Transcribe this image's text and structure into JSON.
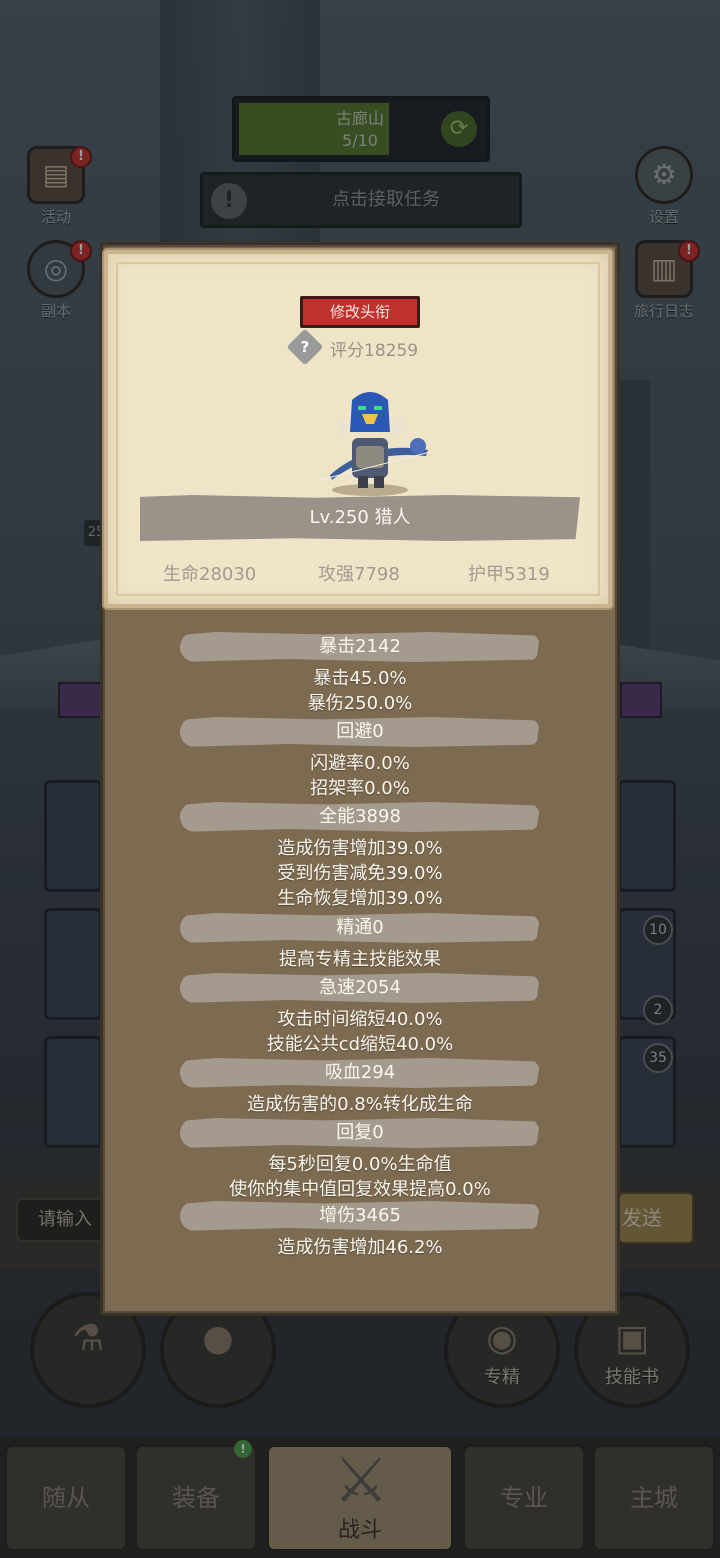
{
  "quest": {
    "name": "古廊山",
    "progress": "5/10",
    "task_label": "点击接取任务"
  },
  "side_buttons": {
    "activity": "活动",
    "dungeon": "副本",
    "settings": "设置",
    "journal": "旅行日志",
    "badge": "!"
  },
  "side_number": "25",
  "cards": {
    "c1": "10",
    "c2": "2",
    "c3": "35"
  },
  "chat": {
    "input_placeholder": "请输入",
    "send_label": "发送"
  },
  "round_buttons": {
    "specialize": "专精",
    "skill_book": "技能书"
  },
  "nav": {
    "followers": "随从",
    "equipment": "装备",
    "battle": "战斗",
    "profession": "专业",
    "main_city": "主城",
    "badge": "!"
  },
  "profile": {
    "change_title": "修改头衔",
    "help": "?",
    "score": "评分18259",
    "level_class": "Lv.250 猎人",
    "hp": "生命28030",
    "attack": "攻强7798",
    "armor": "护甲5319"
  },
  "stats": {
    "crit": {
      "header": "暴击2142",
      "lines": [
        "暴击45.0%",
        "暴伤250.0%"
      ]
    },
    "dodge": {
      "header": "回避0",
      "lines": [
        "闪避率0.0%",
        "招架率0.0%"
      ]
    },
    "versatility": {
      "header": "全能3898",
      "lines": [
        "造成伤害增加39.0%",
        "受到伤害减免39.0%",
        "生命恢复增加39.0%"
      ]
    },
    "mastery": {
      "header": "精通0",
      "lines": [
        "提高专精主技能效果"
      ]
    },
    "haste": {
      "header": "急速2054",
      "lines": [
        "攻击时间缩短40.0%",
        "技能公共cd缩短40.0%"
      ]
    },
    "lifesteal": {
      "header": "吸血294",
      "lines": [
        "造成伤害的0.8%转化成生命"
      ]
    },
    "regen": {
      "header": "回复0",
      "lines": [
        "每5秒回复0.0%生命值",
        "使你的集中值回复效果提高0.0%"
      ]
    },
    "damage": {
      "header": "增伤3465",
      "lines": [
        "造成伤害增加46.2%"
      ]
    }
  }
}
